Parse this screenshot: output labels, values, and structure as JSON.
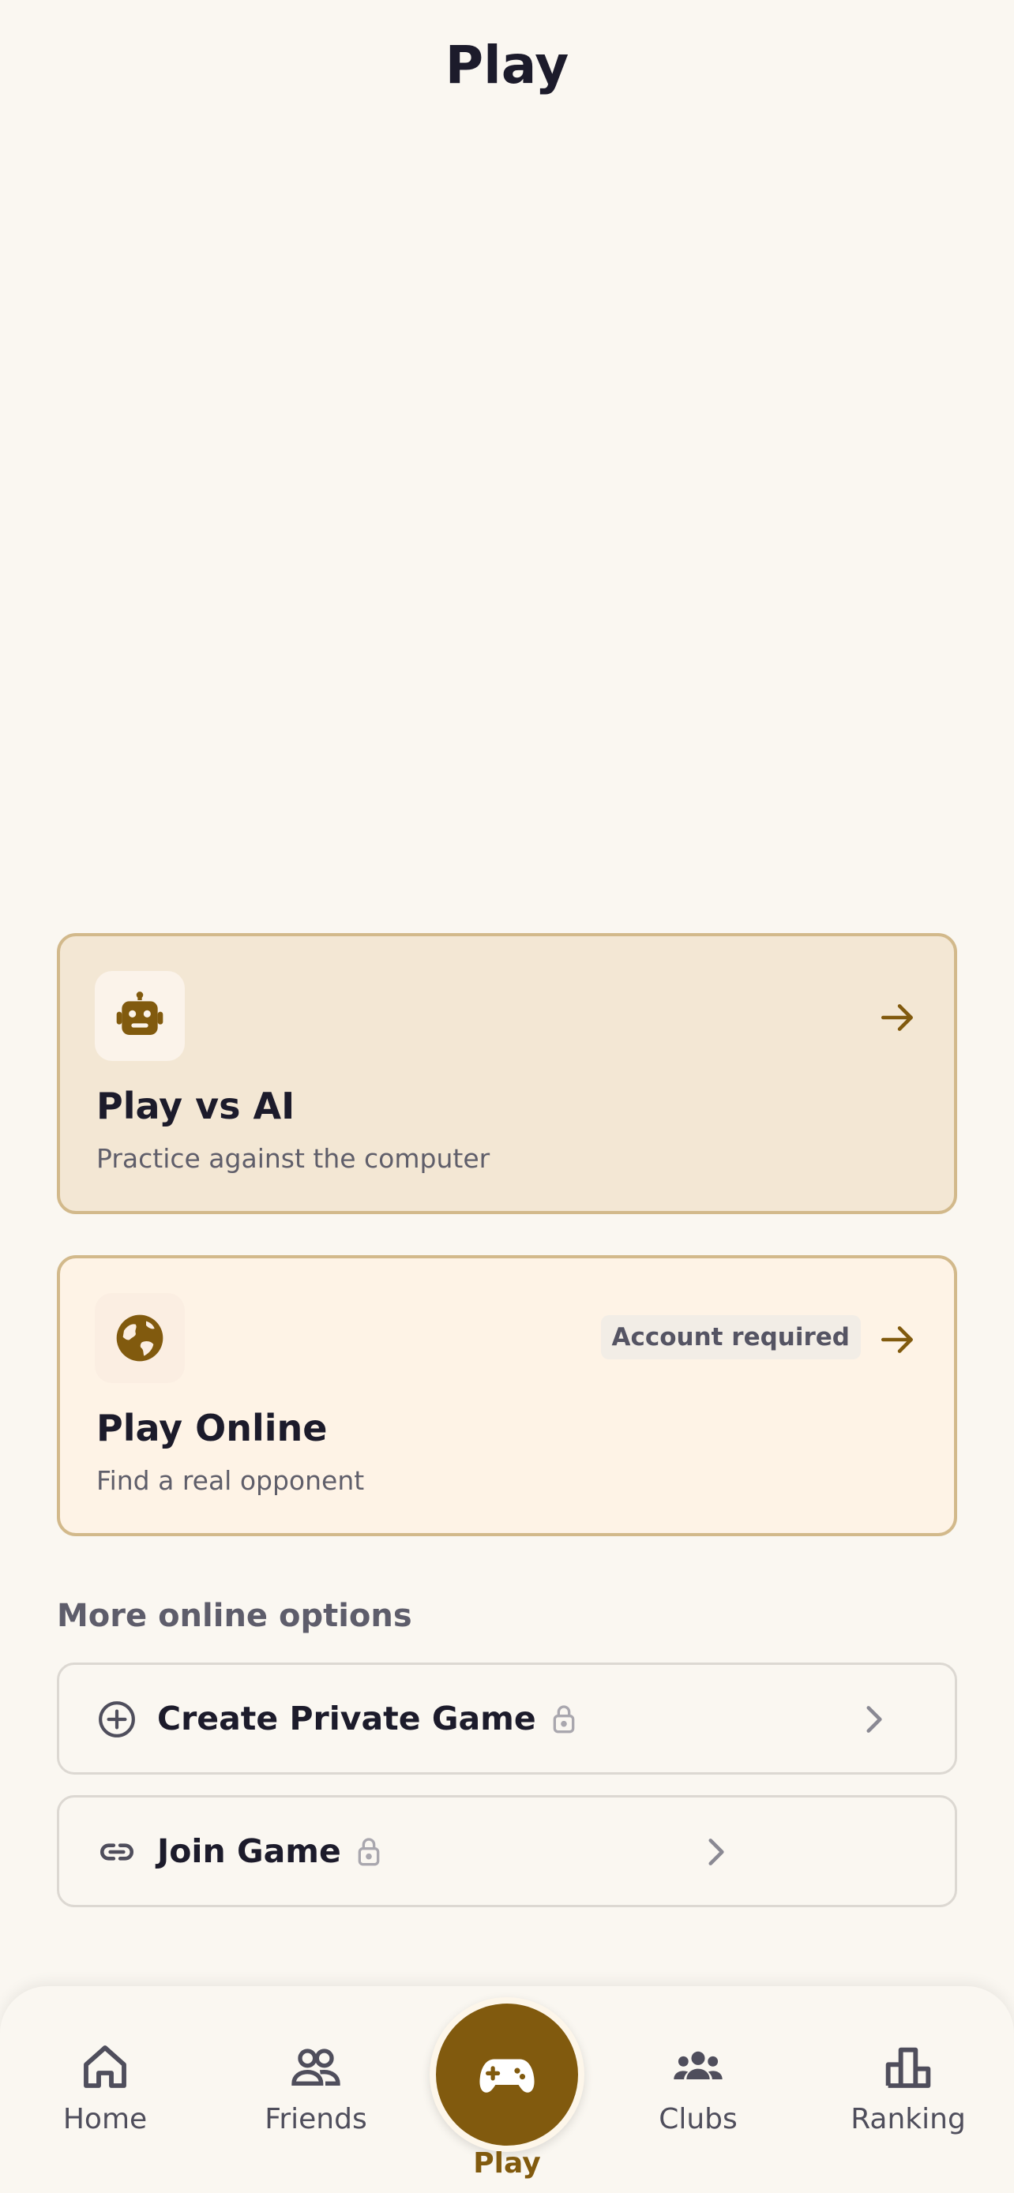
{
  "header": {
    "title": "Play"
  },
  "cards": {
    "ai": {
      "title": "Play vs AI",
      "subtitle": "Practice against the computer",
      "icon": "robot-icon"
    },
    "online": {
      "title": "Play Online",
      "subtitle": "Find a real opponent",
      "badge": "Account required",
      "icon": "globe-icon"
    }
  },
  "more_options": {
    "label": "More online options",
    "items": [
      {
        "label": "Create Private Game",
        "icon": "plus-circle-icon",
        "locked": true
      },
      {
        "label": "Join Game",
        "icon": "link-icon",
        "locked": true
      }
    ]
  },
  "nav": {
    "items": [
      {
        "label": "Home",
        "icon": "home-icon"
      },
      {
        "label": "Friends",
        "icon": "friends-icon"
      },
      {
        "label": "Play",
        "icon": "gamepad-icon",
        "active": true
      },
      {
        "label": "Clubs",
        "icon": "clubs-icon"
      },
      {
        "label": "Ranking",
        "icon": "ranking-icon"
      }
    ]
  },
  "colors": {
    "accent": "#815a0e",
    "background": "#faf7f1",
    "card_ai": "#f3e7d4",
    "card_online": "#fef3e6",
    "border": "#d2b98b"
  }
}
